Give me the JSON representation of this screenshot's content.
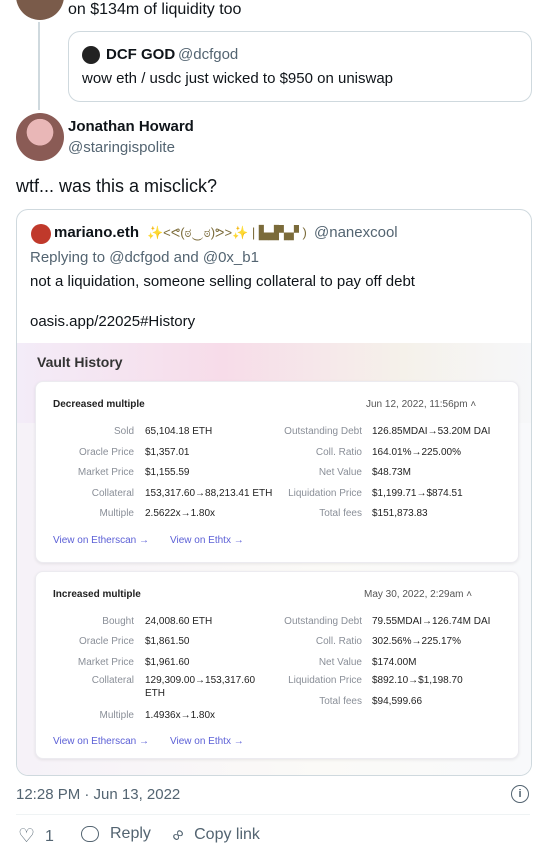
{
  "prev_tweet": {
    "text": "on $134m of liquidity too"
  },
  "quoted_prev": {
    "display_name": "DCF GOD",
    "handle": "@dcfgod",
    "text": "wow eth / usdc just wicked to $950 on uniswap"
  },
  "tweet": {
    "display_name": "Jonathan Howard",
    "handle": "@staringispolite",
    "text": "wtf... was this a misclick?",
    "timestamp": "12:28 PM · Jun 13, 2022"
  },
  "quoted": {
    "display_name": "mariano.eth",
    "name_decor": "✨<ᕙ(ಠ‿ಠ)ᕗ>✨ | ▙▟▚▞ )",
    "handle": "@nanexcool",
    "replying": "Replying to @dcfgod and @0x_b1",
    "text": "not a liquidation, someone selling collateral to pay off debt",
    "link": "oasis.app/22025#History"
  },
  "vault": {
    "title": "Vault History",
    "entries": [
      {
        "title": "Decreased multiple",
        "date": "Jun 12, 2022, 11:56pm",
        "left_labels": [
          "Sold",
          "Oracle Price",
          "Market Price",
          "Collateral",
          "Multiple"
        ],
        "left_values": [
          "65,104.18 ETH",
          "$1,357.01",
          "$1,155.59",
          "153,317.60→88,213.41 ETH",
          "2.5622x→1.80x"
        ],
        "right_labels": [
          "Outstanding Debt",
          "Coll. Ratio",
          "Net Value",
          "Liquidation Price",
          "Total fees"
        ],
        "right_values": [
          "126.85MDAI→53.20M DAI",
          "164.01%→225.00%",
          "$48.73M",
          "$1,199.71→$874.51",
          "$151,873.83"
        ],
        "link1": "View on Etherscan →",
        "link2": "View on Ethtx →"
      },
      {
        "title": "Increased multiple",
        "date": "May 30, 2022, 2:29am",
        "left_labels": [
          "Bought",
          "Oracle Price",
          "Market Price",
          "Collateral",
          "Multiple"
        ],
        "left_values": [
          "24,008.60 ETH",
          "$1,861.50",
          "$1,961.60",
          "129,309.00→153,317.60",
          "1.4936x→1.80x"
        ],
        "collateral_unit": "ETH",
        "right_labels": [
          "Outstanding Debt",
          "Coll. Ratio",
          "Net Value",
          "Liquidation Price",
          "Total fees"
        ],
        "right_values": [
          "79.55MDAI→126.74M DAI",
          "302.56%→225.17%",
          "$174.00M",
          "$892.10→$1,198.70",
          "$94,599.66"
        ],
        "link1": "View on Etherscan →",
        "link2": "View on Ethtx →"
      }
    ]
  },
  "actions": {
    "like_count": "1",
    "reply_label": "Reply",
    "copy_label": "Copy link"
  }
}
